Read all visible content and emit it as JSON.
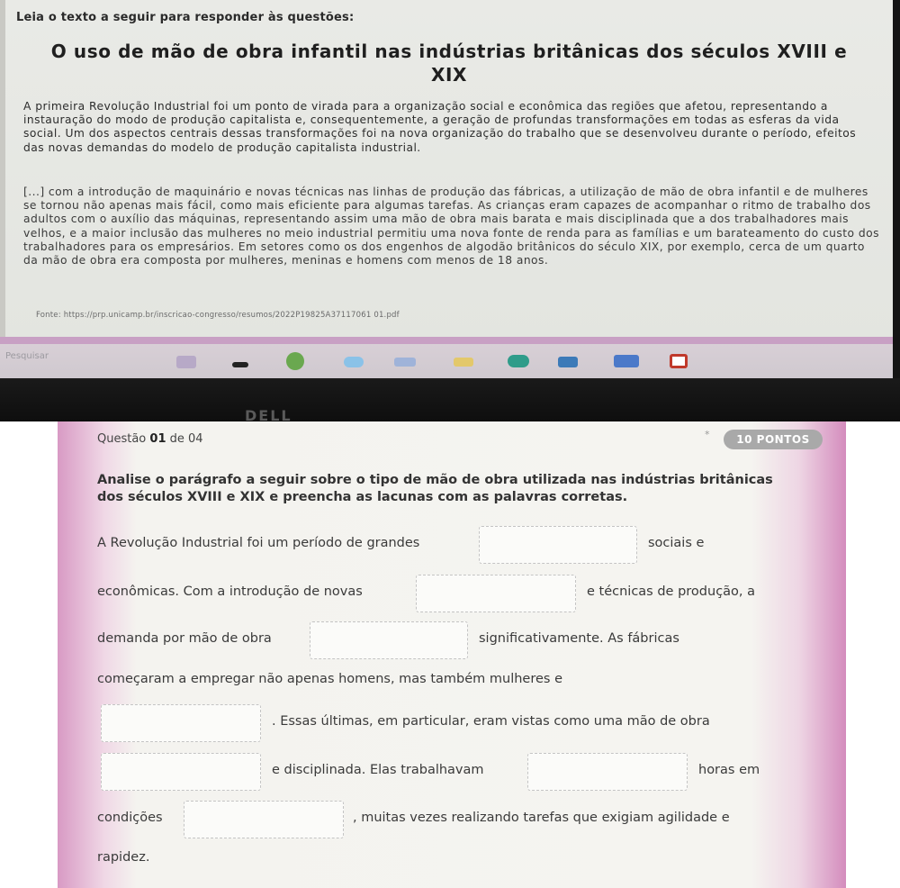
{
  "top_screen": {
    "instruction": "Leia o texto a seguir para responder às questões:",
    "title": "O uso de mão de obra infantil nas indústrias britânicas dos séculos XVIII e XIX",
    "paragraph1": "A primeira Revolução Industrial foi um ponto de virada para a organização social e econômica das regiões que afetou, representando a instauração do modo de produção capitalista e, consequentemente, a geração de profundas transformações em todas as esferas da vida social. Um dos aspectos centrais dessas transformações foi na nova organização do trabalho que se desenvolveu durante o período, efeitos das novas demandas do modelo de produção capitalista industrial.",
    "paragraph2": "[...] com a introdução de maquinário e novas técnicas nas linhas de produção das fábricas, a utilização de mão de obra infantil e de mulheres se tornou não apenas mais fácil, como mais eficiente para algumas tarefas. As crianças eram capazes de acompanhar o ritmo de trabalho dos adultos com o auxílio das máquinas, representando assim uma mão de obra mais barata e mais disciplinada que a dos trabalhadores mais velhos, e a maior inclusão das mulheres no meio industrial permitiu uma nova fonte de renda para as famílias e um barateamento do custo dos trabalhadores para os empresários. Em setores como os dos engenhos de algodão britânicos do século XIX, por exemplo, cerca de um quarto da mão de obra era composta por mulheres, meninas e homens com menos de 18 anos.",
    "source": "Fonte: https://prp.unicamp.br/inscricao-congresso/resumos/2022P19825A37117061 01.pdf",
    "taskbar_search": "Pesquisar",
    "brand": "DELL"
  },
  "question": {
    "number_prefix": "Questão ",
    "number": "01",
    "number_suffix": " de 04",
    "star": "*",
    "points": "10 PONTOS",
    "prompt": "Analise o parágrafo a seguir sobre o tipo de mão de obra utilizada nas indústrias britânicas dos séculos XVIII e XIX e preencha as lacunas com as palavras corretas.",
    "segments": {
      "s1": "A Revolução Industrial foi um período de grandes",
      "s2": "sociais e",
      "s3": "econômicas. Com a introdução de novas",
      "s4": "e técnicas de produção, a",
      "s5": "demanda por mão de obra",
      "s6": "significativamente. As fábricas",
      "s7": "começaram a empregar não apenas homens, mas também mulheres e",
      "s8": ". Essas últimas, em particular, eram vistas como uma mão de obra",
      "s9": "e disciplinada. Elas trabalhavam",
      "s10": "horas em",
      "s11": "condições",
      "s12": ", muitas vezes realizando tarefas que exigiam agilidade e",
      "s13": "rapidez."
    },
    "blanks": [
      "",
      "",
      "",
      "",
      "",
      "",
      ""
    ]
  },
  "colors": {
    "points_badge": "#a9a9a9",
    "pink_frame": "#d89ac4"
  }
}
